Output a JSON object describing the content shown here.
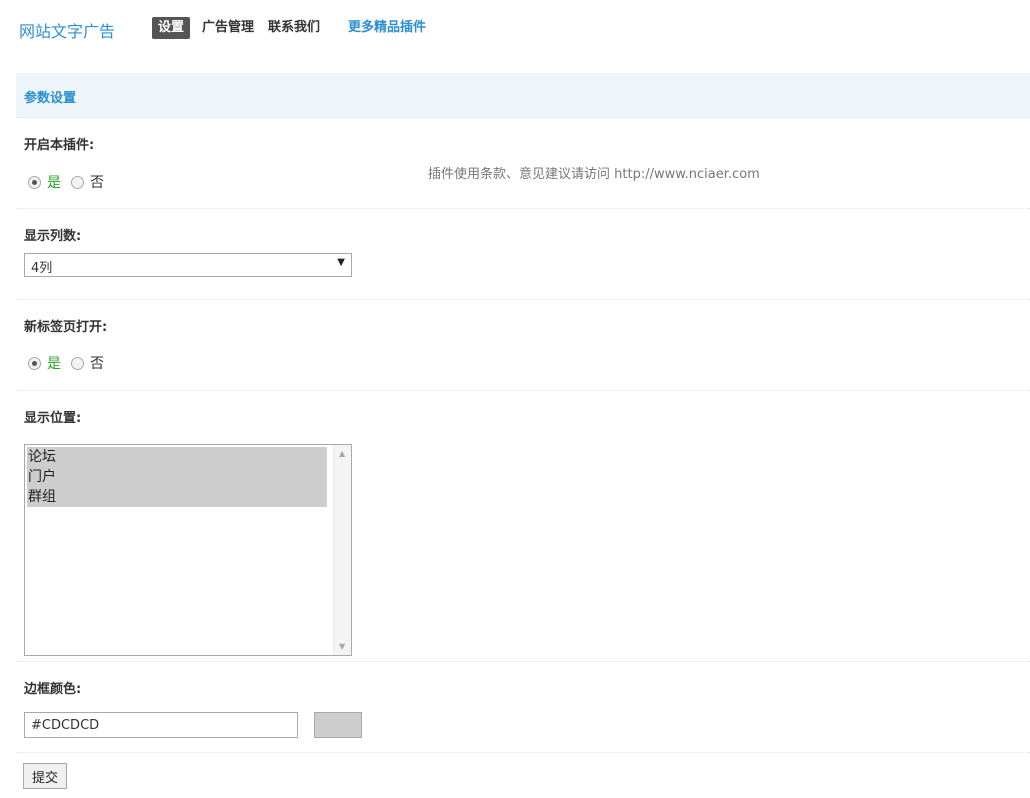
{
  "header": {
    "brand": "网站文字广告",
    "nav": [
      {
        "label": "设置",
        "active": true
      },
      {
        "label": "广告管理",
        "active": false
      },
      {
        "label": "联系我们",
        "active": false
      }
    ],
    "more_plugins_label": "更多精品插件"
  },
  "section": {
    "title": "参数设置"
  },
  "settings": {
    "enable_plugin": {
      "label": "开启本插件:",
      "options": [
        "是",
        "否"
      ],
      "selected": "是",
      "notice": "插件使用条款、意见建议请访问 http://www.nciaer.com"
    },
    "columns": {
      "label": "显示列数:",
      "value": "4列"
    },
    "new_tab": {
      "label": "新标签页打开:",
      "options": [
        "是",
        "否"
      ],
      "selected": "是"
    },
    "position": {
      "label": "显示位置:",
      "options": [
        "论坛",
        "门户",
        "群组"
      ],
      "selected": [
        "论坛",
        "门户",
        "群组"
      ]
    },
    "border_color": {
      "label": "边框颜色:",
      "value": "#CDCDCD",
      "swatch": "#cdcdcd"
    }
  },
  "submit_label": "提交"
}
